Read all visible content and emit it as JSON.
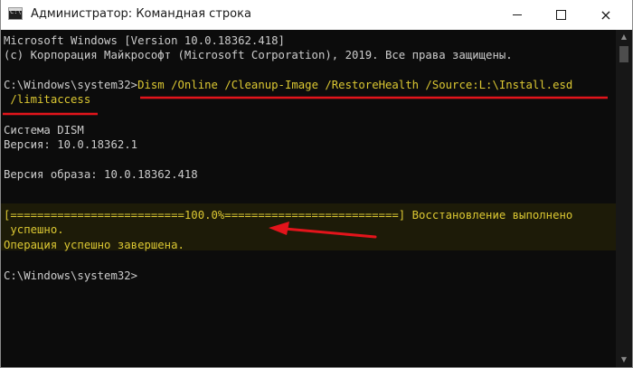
{
  "window": {
    "title": "Администратор: Командная строка",
    "icon_text": "C:\\"
  },
  "controls": {
    "minimize": "minimize-icon",
    "maximize": "maximize-icon",
    "close": "×"
  },
  "console": {
    "lines": {
      "l1": "Microsoft Windows [Version 10.0.18362.418]",
      "l2": "(c) Корпорация Майкрософт (Microsoft Corporation), 2019. Все права защищены.",
      "prompt1": "C:\\Windows\\system32>",
      "cmd1": "Dism /Online /Cleanup-Image /RestoreHealth /Source:L:\\Install.esd",
      "cmd2": " /limitaccess",
      "sys": "Система DISM",
      "ver": "Версия: 10.0.18362.1",
      "imgver": "Версия образа: 10.0.18362.418",
      "progress": "[==========================100.0%==========================] Восстановление выполнено",
      "progress2": " успешно.",
      "done": "Операция успешно завершена.",
      "prompt2": "C:\\Windows\\system32>"
    }
  },
  "colors": {
    "console_bg": "#0c0c0c",
    "text": "#cccccc",
    "highlight_text": "#dcc832",
    "annotation": "#e3141b"
  }
}
